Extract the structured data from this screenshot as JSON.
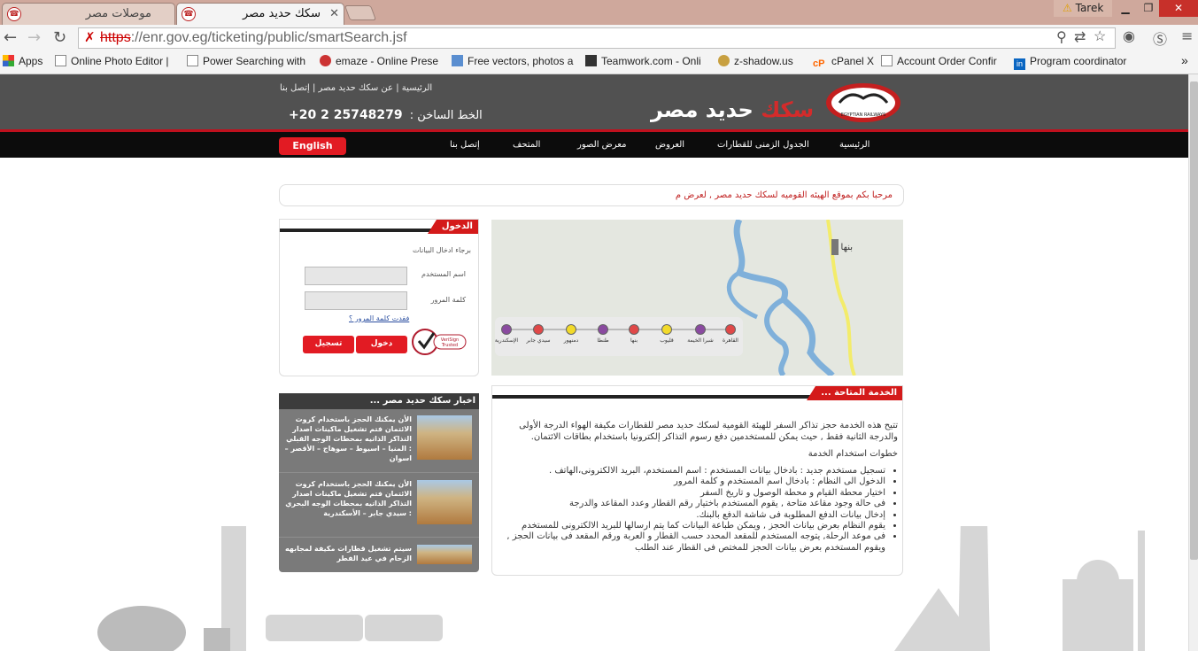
{
  "browser": {
    "tabs": [
      {
        "title": "موصلات مصر",
        "favicon": "enr-logo"
      },
      {
        "title": "سكك حديد مصر",
        "favicon": "enr-logo"
      }
    ],
    "user": "Tarek",
    "url_scheme": "https",
    "url_rest": "://enr.gov.eg/ticketing/public/smartSearch.jsf",
    "bookmarks": [
      "Apps",
      "Online Photo Editor |",
      "Power Searching with",
      "emaze - Online Prese",
      "Free vectors, photos a",
      "Teamwork.com - Onli",
      "z-shadow.us",
      "cPanel X",
      "Account Order Confir",
      "Program coordinator"
    ]
  },
  "site": {
    "top_links": "الرئيسية | عن سكك حديد مصر | إتصل بنا",
    "hotline_label": "الخط الساخن :",
    "hotline_number": "+20 2 25748279",
    "brand_red": "سكك",
    "brand_white": "حديد مصر",
    "logo_caption": "EGYPTIAN RAILWAYS",
    "nav": [
      "الرئيسية",
      "الجدول الزمنى للقطارات",
      "العروض",
      "معرض الصور",
      "المتحف",
      "إتصل بنا"
    ],
    "english_button": "English",
    "welcome": "مرحبا بكم بموقع الهيئه القوميه لسكك حديد مصر , لعرض م",
    "login": {
      "title": "الدخول",
      "prompt": "برجاء ادخال البيانات",
      "username_label": "اسم المستخدم",
      "password_label": "كلمة المرور",
      "forgot": "فقدت كلمة المرور ؟",
      "login_button": "دخول",
      "register_button": "تسجيل",
      "badge_line1": "VeriSign",
      "badge_line2": "Trusted"
    },
    "map": {
      "city_label": "بنها",
      "stations": [
        "القاهرة",
        "شبرا الخيمة",
        "قليوب",
        "بنها",
        "طنطا",
        "دمنهور",
        "سيدي جابر",
        "الإسكندرية"
      ]
    },
    "news": {
      "title": "اخبار سكك حديد مصر ...",
      "items": [
        "الأن يمكنك الحجز باستخدام كروت الائتمان فتم تشغيل ماكينات اصدار التذاكر الذاتيه بمحطات الوجه القبلي : المنيا – اسيوط – سوهاج – الأقصر – اسوان",
        "الأن يمكنك الحجز باستخدام كروت الائتمان فتم تشغيل ماكينات اصدار التذاكر الذاتيه بمحطات الوجه البحري : سيدي جابر – الأسكندرية",
        "سيتم تشغيل قطارات مكيفة لمجابهه الزحام في عيد الفطر"
      ]
    },
    "service": {
      "title": "الخدمة المتاحة ...",
      "intro": "تتيح هذه الخدمة حجز تذاكر السفر للهيئة القومية لسكك حديد مصر للقطارات مكيفة الهواء الدرجة الأولى والدرجة الثانية فقط , حيث يمكن للمستخدمين دفع رسوم التذاكر إلكترونيا باستخدام بطاقات الائتمان.",
      "steps_title": "خطوات استخدام الخدمة",
      "steps": [
        "تسجيل مستخدم جديد : بادخال بيانات المستخدم : اسم المستخدم، البريد الالكترونى،الهاتف .",
        "الدخول الى النظام : بادخال اسم المستخدم و كلمة المرور",
        "اختيار محطة القيام و محطة الوصول و تاريخ السفر",
        "فى حالة وجود مقاعد متاحة , يقوم المستخدم باختيار رقم القطار وعدد المقاعد والدرجة",
        "إدخال بيانات الدفع المطلوبة فى شاشة الدفع بالبنك.",
        "يقوم النظام بعرض بيانات الحجز , ويمكن طباعة البيانات كما يتم ارسالها للبريد الالكترونى للمستخدم",
        "فى موعد الرحلة, يتوجه المستخدم للمقعد المحدد حسب القطار و العربة ورقم المقعد فى بيانات الحجز , ويقوم المستخدم بعرض بيانات الحجز للمختص فى القطار عند الطلب"
      ]
    },
    "colors": {
      "header_bg": "#515151",
      "accent_red": "#e21b23",
      "nav_bg": "#0c0c0c"
    }
  }
}
